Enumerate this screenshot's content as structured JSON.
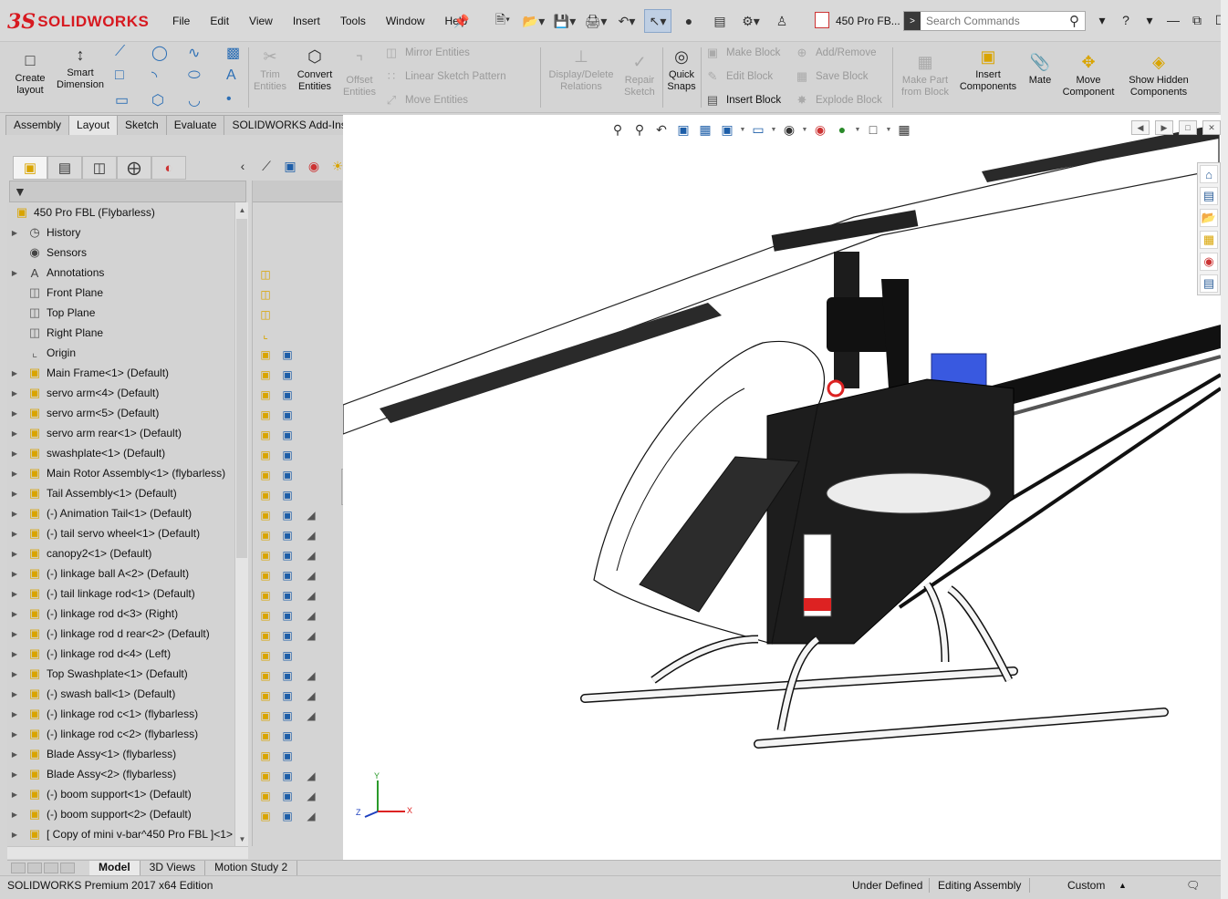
{
  "app": {
    "brand_ds": "3S",
    "brand_name": "SOLIDWORKS",
    "document_title": "450 Pro FB...",
    "search_placeholder": "Search Commands",
    "help_label": "?"
  },
  "menu": [
    "File",
    "Edit",
    "View",
    "Insert",
    "Tools",
    "Window",
    "Help"
  ],
  "ribbon": {
    "create_layout": "Create layout",
    "smart_dimension": "Smart Dimension",
    "trim_entities": "Trim Entities",
    "convert_entities": "Convert Entities",
    "offset_entities": "Offset Entities",
    "mirror_entities": "Mirror Entities",
    "linear_sketch_pattern": "Linear Sketch Pattern",
    "move_entities": "Move Entities",
    "display_delete_relations": "Display/Delete Relations",
    "repair_sketch": "Repair Sketch",
    "quick_snaps": "Quick Snaps",
    "make_block": "Make Block",
    "edit_block": "Edit Block",
    "insert_block": "Insert Block",
    "add_remove": "Add/Remove",
    "save_block": "Save Block",
    "explode_block": "Explode Block",
    "make_part_from_block": "Make Part from Block",
    "insert_components": "Insert Components",
    "mate": "Mate",
    "move_component": "Move Component",
    "show_hidden_components": "Show Hidden Components"
  },
  "tabs": [
    "Assembly",
    "Layout",
    "Sketch",
    "Evaluate",
    "SOLIDWORKS Add-Ins"
  ],
  "active_tab": "Layout",
  "tree": {
    "root": "450 Pro FBL  (Flybarless)",
    "items": [
      {
        "label": "History",
        "icon": "history-icon",
        "exp": true,
        "cols": ""
      },
      {
        "label": "Sensors",
        "icon": "sensors-icon",
        "exp": false,
        "cols": ""
      },
      {
        "label": "Annotations",
        "icon": "annotations-icon",
        "exp": true,
        "cols": ""
      },
      {
        "label": "Front Plane",
        "icon": "plane-icon",
        "exp": false,
        "cols": "p"
      },
      {
        "label": "Top Plane",
        "icon": "plane-icon",
        "exp": false,
        "cols": "p"
      },
      {
        "label": "Right Plane",
        "icon": "plane-icon",
        "exp": false,
        "cols": "p"
      },
      {
        "label": "Origin",
        "icon": "origin-icon",
        "exp": false,
        "cols": "o"
      },
      {
        "label": "Main Frame<1> (Default)",
        "icon": "assembly-icon",
        "exp": true,
        "cols": "ab"
      },
      {
        "label": "servo arm<4> (Default)",
        "icon": "assembly-icon",
        "exp": true,
        "cols": "ab"
      },
      {
        "label": "servo arm<5> (Default)",
        "icon": "assembly-icon",
        "exp": true,
        "cols": "ab"
      },
      {
        "label": "servo arm rear<1> (Default)",
        "icon": "assembly-icon",
        "exp": true,
        "cols": "ab"
      },
      {
        "label": "swashplate<1> (Default)",
        "icon": "assembly-icon",
        "exp": true,
        "cols": "ab"
      },
      {
        "label": "Main Rotor Assembly<1> (flybarless)",
        "icon": "assembly-icon",
        "exp": true,
        "cols": "ab"
      },
      {
        "label": "Tail Assembly<1> (Default)",
        "icon": "assembly-icon",
        "exp": true,
        "cols": "ab"
      },
      {
        "label": "(-) Animation Tail<1> (Default)",
        "icon": "part-icon",
        "exp": true,
        "cols": "ab"
      },
      {
        "label": "(-) tail servo wheel<1> (Default)",
        "icon": "part-icon",
        "exp": true,
        "cols": "abs"
      },
      {
        "label": "canopy2<1> (Default)",
        "icon": "part-icon",
        "exp": true,
        "cols": "abs"
      },
      {
        "label": "(-) linkage ball A<2> (Default)",
        "icon": "part-icon",
        "exp": true,
        "cols": "abs"
      },
      {
        "label": "(-) tail linkage rod<1> (Default)",
        "icon": "part-icon",
        "exp": true,
        "cols": "abs"
      },
      {
        "label": "(-) linkage rod d<3> (Right)",
        "icon": "part-icon",
        "exp": true,
        "cols": "abs"
      },
      {
        "label": "(-) linkage rod d rear<2> (Default)",
        "icon": "part-icon",
        "exp": true,
        "cols": "abs"
      },
      {
        "label": "(-) linkage rod d<4> (Left)",
        "icon": "part-icon",
        "exp": true,
        "cols": "abs"
      },
      {
        "label": "Top Swashplate<1> (Default)",
        "icon": "assembly-icon",
        "exp": true,
        "cols": "ab"
      },
      {
        "label": "(-) swash ball<1> (Default)",
        "icon": "part-icon",
        "exp": true,
        "cols": "abs"
      },
      {
        "label": "(-) linkage rod c<1> (flybarless)",
        "icon": "part-icon",
        "exp": true,
        "cols": "abs"
      },
      {
        "label": "(-) linkage rod c<2> (flybarless)",
        "icon": "part-icon",
        "exp": true,
        "cols": "abs"
      },
      {
        "label": "Blade Assy<1> (flybarless)",
        "icon": "assembly-icon",
        "exp": true,
        "cols": "ab"
      },
      {
        "label": "Blade Assy<2> (flybarless)",
        "icon": "assembly-icon",
        "exp": true,
        "cols": "ab"
      },
      {
        "label": "(-) boom support<1> (Default)",
        "icon": "part-icon",
        "exp": true,
        "cols": "abs"
      },
      {
        "label": "(-) boom support<2> (Default)",
        "icon": "part-icon",
        "exp": true,
        "cols": "abs"
      },
      {
        "label": "[ Copy of mini v-bar^450 Pro FBL ]<1>",
        "icon": "part-icon",
        "exp": true,
        "cols": "abs"
      }
    ]
  },
  "bottom_tabs": [
    "Model",
    "3D Views",
    "Motion Study 2"
  ],
  "active_bottom_tab": "Model",
  "status": {
    "edition": "SOLIDWORKS Premium 2017 x64 Edition",
    "definition": "Under Defined",
    "mode": "Editing Assembly",
    "units": "Custom"
  },
  "triad": {
    "x": "X",
    "y": "Y",
    "z": "Z"
  },
  "colors": {
    "brand": "#d71920",
    "accent": "#1d5ea8",
    "part_yellow": "#d9a400"
  }
}
